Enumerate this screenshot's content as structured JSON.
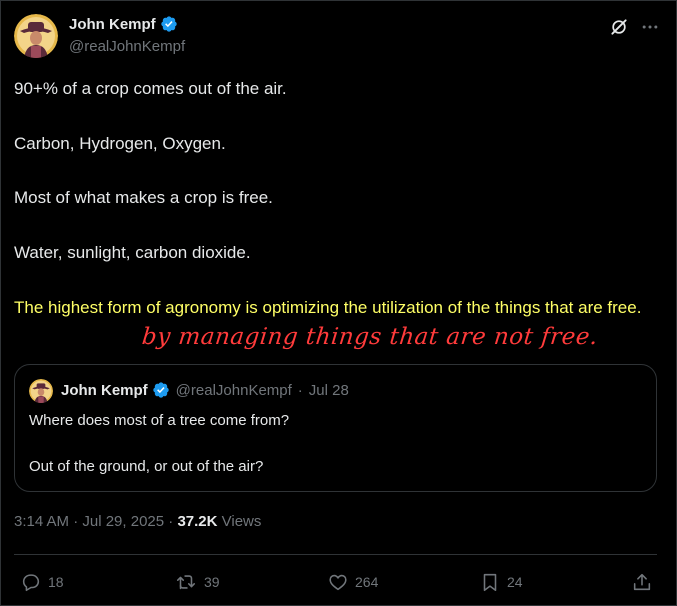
{
  "tweet": {
    "author": {
      "name": "John Kempf",
      "handle": "@realJohnKempf",
      "verified": true,
      "verified_color": "#1d9bf0"
    },
    "text_lines": [
      "90+% of a crop comes out of the air.",
      "Carbon, Hydrogen, Oxygen.",
      "Most of what makes a crop is free.",
      "Water, sunlight, carbon dioxide."
    ],
    "highlighted_text": "The highest form of agronomy is optimizing the utilization of the things that are free.",
    "highlight_color": "#ffff66",
    "handwritten_annotation": "by managing things that are not free.",
    "annotation_color": "#ff3b3b",
    "quoted_tweet": {
      "name": "John Kempf",
      "handle": "@realJohnKempf",
      "separator": "·",
      "date": "Jul 28",
      "lines": [
        "Where does most of a tree come from?",
        "Out of the ground, or out of the air?"
      ]
    },
    "timestamp": "3:14 AM · Jul 29, 2025 ·",
    "views_count": "37.2K",
    "views_label": "Views",
    "actions": {
      "replies": "18",
      "reposts": "39",
      "likes": "264",
      "bookmarks": "24"
    },
    "icons": {
      "top": [
        "grok-icon",
        "more-icon"
      ],
      "actions": [
        "reply-icon",
        "repost-icon",
        "like-icon",
        "bookmark-icon",
        "share-icon"
      ]
    }
  }
}
